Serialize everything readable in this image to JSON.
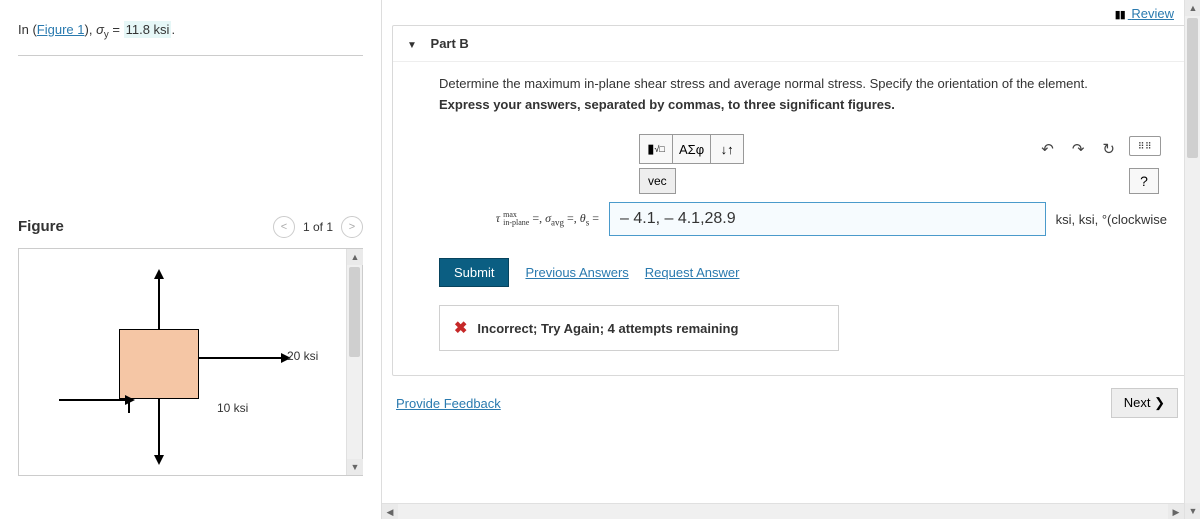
{
  "problem": {
    "prefix": "In (",
    "figure_link_text": "Figure 1",
    "suffix_before_value": "), σ",
    "subscript": "y",
    "equals": " = ",
    "highlighted_value": "11.8 ksi",
    "period": "."
  },
  "figure_panel": {
    "title": "Figure",
    "page_label": "1 of 1",
    "labels": {
      "right": "20 ksi",
      "bottom": "10 ksi"
    }
  },
  "review": {
    "label": "Review"
  },
  "part": {
    "title": "Part B",
    "prompt1": "Determine the maximum in-plane shear stress and average normal stress. Specify the orientation of the element.",
    "prompt2": "Express your answers, separated by commas, to three significant figures.",
    "toolbar": {
      "templates_aria": "templates",
      "greek": "ΑΣφ",
      "swap_aria": "↓↑",
      "vec": "vec",
      "help": "?"
    },
    "icons": {
      "undo": "↶",
      "redo": "↷",
      "reset": "↻",
      "keyboard": "⌨"
    },
    "answer_label_html": "τ <sub>in-plane</sub><sup style='font-size:0.7em;position:relative;left:-28px;top:-6px'>max</sup> =, σ<sub>avg</sub> =, θ<sub>s</sub> =",
    "answer_value": "– 4.1, – 4.1,28.9",
    "units": "ksi, ksi, °(clockwise",
    "submit": "Submit",
    "prev_answers": "Previous Answers",
    "request_answer": "Request Answer",
    "feedback": "Incorrect; Try Again; 4 attempts remaining"
  },
  "footer": {
    "provide_feedback": "Provide Feedback",
    "next": "Next ❯"
  }
}
